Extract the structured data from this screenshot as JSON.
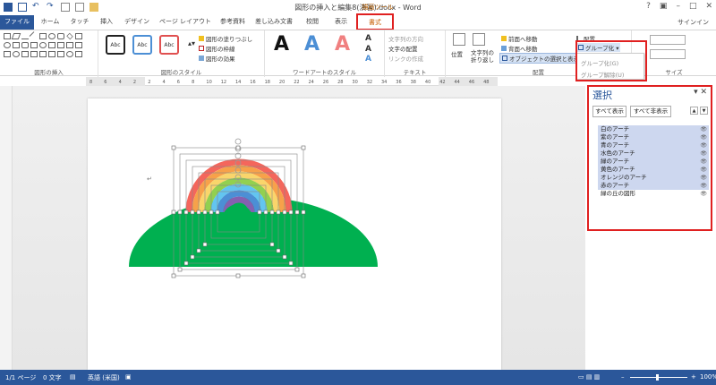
{
  "titlebar": {
    "title": "図形の挿入と編集8(演習).docx - Word",
    "context_tool_title": "描画ツール",
    "window_buttons": [
      "?",
      "▣",
      "–",
      "□",
      "✕"
    ]
  },
  "tabs": {
    "file": "ファイル",
    "items": [
      "ホーム",
      "タッチ",
      "挿入",
      "デザイン",
      "ページ レイアウト",
      "参考資料",
      "差し込み文書",
      "校閲",
      "表示"
    ],
    "active": "書式",
    "signin": "サインイン"
  },
  "ribbon": {
    "groups": {
      "insert_shapes": "図形の挿入",
      "shape_styles": "図形のスタイル",
      "wordart_styles": "ワードアートのスタイル",
      "text": "テキスト",
      "arrange": "配置",
      "size": "サイズ"
    },
    "style_swatches": [
      "Abc",
      "Abc",
      "Abc"
    ],
    "shape_fill": "図形の塗りつぶし",
    "shape_outline": "図形の枠線",
    "shape_effects": "図形の効果",
    "wordart_letters": [
      "A",
      "A",
      "A"
    ],
    "text_direction": "文字列の方向",
    "text_align": "文字の配置",
    "create_link": "リンクの作成",
    "position": "位置",
    "wrap_text_1": "文字列の",
    "wrap_text_2": "折り返し",
    "bring_forward": "前面へ移動",
    "send_backward": "背面へ移動",
    "selection_pane": "オブジェクトの選択と表示",
    "align": "配置",
    "group": "グループ化",
    "group_menu": {
      "group": "グループ化(G)",
      "ungroup": "グループ解除(U)"
    }
  },
  "ruler": {
    "labels": [
      "8",
      "6",
      "4",
      "2",
      "2",
      "4",
      "6",
      "8",
      "10",
      "12",
      "14",
      "16",
      "18",
      "20",
      "22",
      "24",
      "26",
      "28",
      "30",
      "32",
      "34",
      "36",
      "38",
      "40",
      "42",
      "44",
      "46",
      "48"
    ]
  },
  "selection_pane": {
    "title": "選択",
    "show_all": "すべて表示",
    "hide_all": "すべて非表示",
    "items": [
      {
        "label": "白のアーチ",
        "selected": true
      },
      {
        "label": "紫のアーチ",
        "selected": true
      },
      {
        "label": "青のアーチ",
        "selected": true
      },
      {
        "label": "水色のアーチ",
        "selected": true
      },
      {
        "label": "緑のアーチ",
        "selected": true
      },
      {
        "label": "黄色のアーチ",
        "selected": true
      },
      {
        "label": "オレンジのアーチ",
        "selected": true
      },
      {
        "label": "赤のアーチ",
        "selected": true
      },
      {
        "label": "緑の丘の図形",
        "selected": false
      }
    ]
  },
  "statusbar": {
    "page": "1/1 ページ",
    "words": "0 文字",
    "language": "英語 (米国)",
    "zoom": "100%"
  },
  "colors": {
    "accent": "#2b579a",
    "highlight": "#e02020",
    "hill": "#00b050",
    "arch_red": "#f4665c",
    "arch_orange": "#f7a14a",
    "arch_yellow": "#fad56b",
    "arch_green": "#92d050",
    "arch_lightblue": "#63c5f0",
    "arch_blue": "#4c8fd5",
    "arch_purple": "#8560b0"
  }
}
